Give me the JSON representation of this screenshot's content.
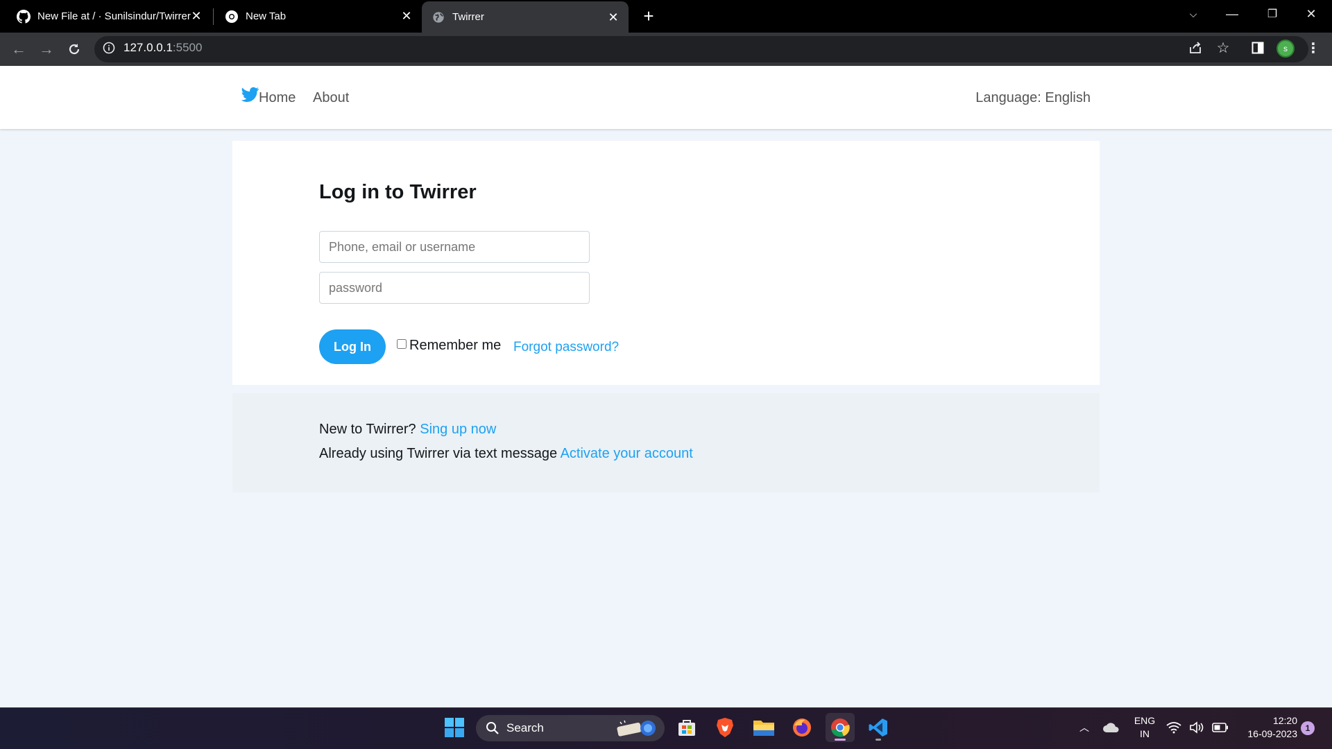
{
  "browser": {
    "tabs": [
      {
        "title": "New File at / · Sunilsindur/Twirrer",
        "icon": "github-icon",
        "active": false
      },
      {
        "title": "New Tab",
        "icon": "chrome-icon",
        "active": false
      },
      {
        "title": "Twirrer",
        "icon": "globe-icon",
        "active": true
      }
    ],
    "url_host": "127.0.0.1",
    "url_port": ":5500",
    "profile_initial": "s"
  },
  "nav": {
    "home_label": "Home",
    "about_label": "About",
    "language_label": "Language: English"
  },
  "login": {
    "title": "Log in to Twirrer",
    "username_placeholder": "Phone, email or username",
    "password_placeholder": "password",
    "login_button": "Log In",
    "remember_label": "Remember me",
    "forgot_link": "Forgot password?"
  },
  "footer": {
    "signup_prefix": "New to Twirrer?",
    "signup_link": "Sing up now",
    "activate_prefix": "Already using Twirrer via text message",
    "activate_link": "Activate your account"
  },
  "taskbar": {
    "search_label": "Search",
    "lang_line1": "ENG",
    "lang_line2": "IN",
    "time": "12:20",
    "date": "16-09-2023",
    "notification_count": "1"
  },
  "colors": {
    "accent": "#1da1f2",
    "page_background": "#f0f5fb",
    "footer_background": "#ebf1f5"
  }
}
